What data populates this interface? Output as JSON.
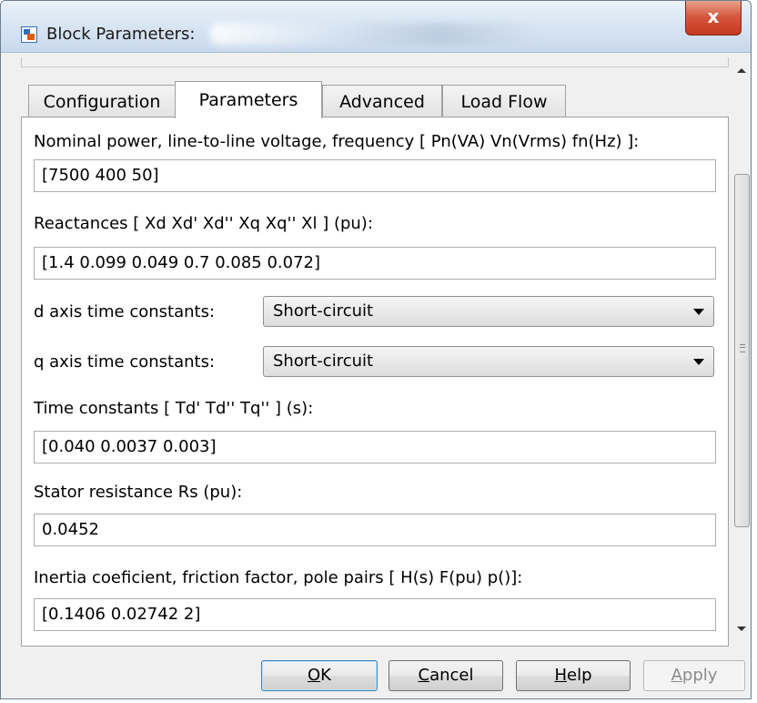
{
  "window": {
    "title": "Block Parameters:",
    "close_glyph": "x"
  },
  "tabs": [
    {
      "label": "Configuration",
      "active": false
    },
    {
      "label": "Parameters",
      "active": true
    },
    {
      "label": "Advanced",
      "active": false
    },
    {
      "label": "Load Flow",
      "active": false
    }
  ],
  "params": {
    "nominal_label": "Nominal power, line-to-line voltage, frequency [ Pn(VA)  Vn(Vrms)  fn(Hz) ]:",
    "nominal_value": "[7500 400 50]",
    "reactances_label": "Reactances [ Xd  Xd'  Xd''  Xq  Xq''  Xl ] (pu):",
    "reactances_value": "[1.4 0.099 0.049 0.7 0.085 0.072]",
    "d_axis_label": "d axis time constants:",
    "d_axis_value": "Short-circuit",
    "q_axis_label": "q axis time constants:",
    "q_axis_value": "Short-circuit",
    "time_constants_label": "Time constants [ Td'  Td''  Tq'' ] (s):",
    "time_constants_value": "[0.040 0.0037 0.003]",
    "stator_label": "Stator resistance Rs (pu):",
    "stator_value": "0.0452",
    "inertia_label": "Inertia coeficient, friction factor, pole pairs [ H(s)  F(pu)  p()]:",
    "inertia_value": "[0.1406 0.02742 2]"
  },
  "buttons": {
    "ok_mnemonic": "O",
    "ok_rest": "K",
    "cancel_mnemonic": "C",
    "cancel_rest": "ancel",
    "help_mnemonic": "H",
    "help_rest": "elp",
    "apply_mnemonic": "A",
    "apply_rest": "pply"
  },
  "icons": {
    "app": "block-parameters-icon",
    "close": "close-icon",
    "dropdown": "chevron-down-icon",
    "scroll_up": "scroll-up-icon",
    "scroll_down": "scroll-down-icon"
  }
}
